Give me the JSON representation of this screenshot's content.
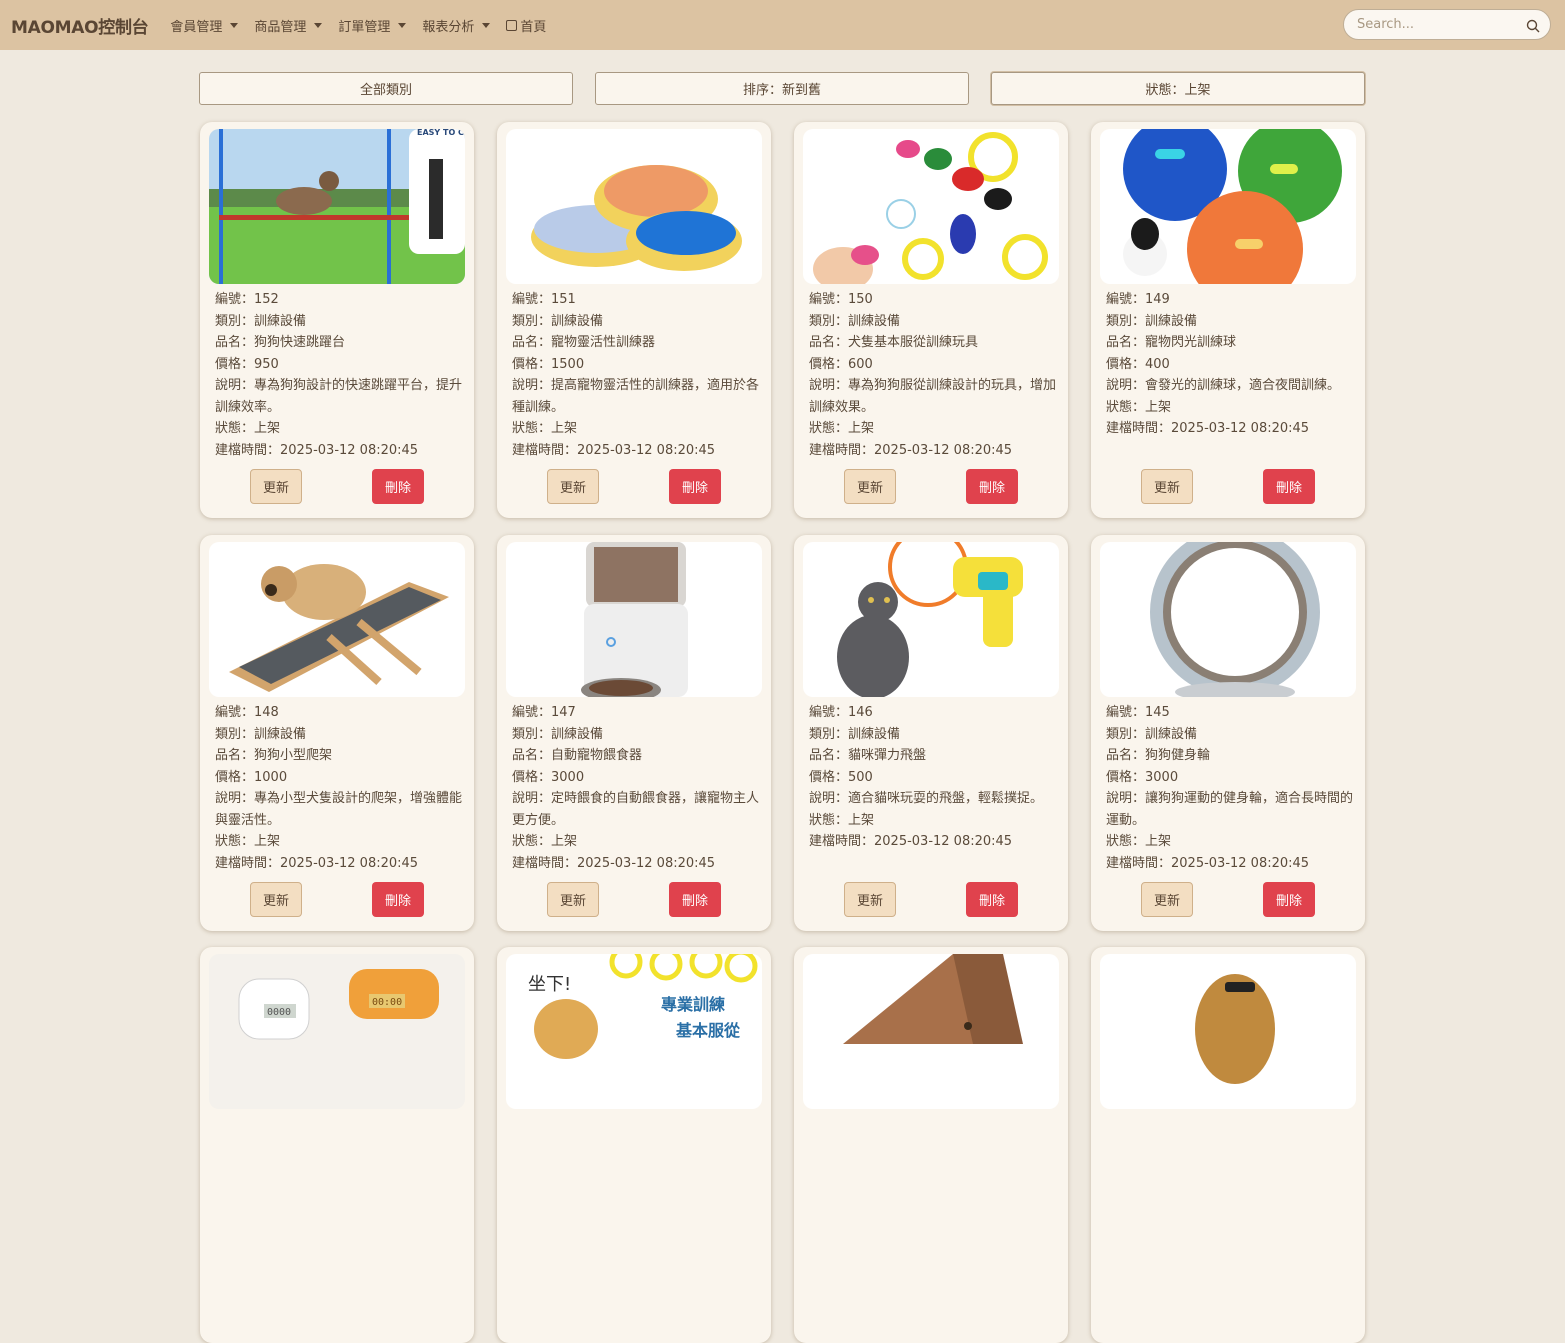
{
  "nav": {
    "brand": "MAOMAO控制台",
    "menu": [
      "會員管理",
      "商品管理",
      "訂單管理",
      "報表分析"
    ],
    "home": "首頁",
    "search_placeholder": "Search..."
  },
  "filters": [
    "全部類別",
    "排序：新到舊",
    "狀態：上架"
  ],
  "products": [
    {
      "id": "編號：152",
      "cat": "類別：訓練設備",
      "name": "品名：狗狗快速跳躍台",
      "price": "價格：950",
      "desc": "說明：專為狗狗設計的快速跳躍平台，提升訓練效率。",
      "status": "狀態：上架",
      "time": "建檔時間：2025-03-12 08:20:45",
      "img_text": "EASY TO CARRY"
    },
    {
      "id": "編號：151",
      "cat": "類別：訓練設備",
      "name": "品名：寵物靈活性訓練器",
      "price": "價格：1500",
      "desc": "說明：提高寵物靈活性的訓練器，適用於各種訓練。",
      "status": "狀態：上架",
      "time": "建檔時間：2025-03-12 08:20:45"
    },
    {
      "id": "編號：150",
      "cat": "類別：訓練設備",
      "name": "品名：犬隻基本服從訓練玩具",
      "price": "價格：600",
      "desc": "說明：專為狗狗服從訓練設計的玩具，增加訓練效果。",
      "status": "狀態：上架",
      "time": "建檔時間：2025-03-12 08:20:45"
    },
    {
      "id": "編號：149",
      "cat": "類別：訓練設備",
      "name": "品名：寵物閃光訓練球",
      "price": "價格：400",
      "desc": "說明：會發光的訓練球，適合夜間訓練。",
      "status": "狀態：上架",
      "time": "建檔時間：2025-03-12 08:20:45"
    },
    {
      "id": "編號：148",
      "cat": "類別：訓練設備",
      "name": "品名：狗狗小型爬架",
      "price": "價格：1000",
      "desc": "說明：專為小型犬隻設計的爬架，增強體能與靈活性。",
      "status": "狀態：上架",
      "time": "建檔時間：2025-03-12 08:20:45"
    },
    {
      "id": "編號：147",
      "cat": "類別：訓練設備",
      "name": "品名：自動寵物餵食器",
      "price": "價格：3000",
      "desc": "說明：定時餵食的自動餵食器，讓寵物主人更方便。",
      "status": "狀態：上架",
      "time": "建檔時間：2025-03-12 08:20:45"
    },
    {
      "id": "編號：146",
      "cat": "類別：訓練設備",
      "name": "品名：貓咪彈力飛盤",
      "price": "價格：500",
      "desc": "說明：適合貓咪玩耍的飛盤，輕鬆撲捉。",
      "status": "狀態：上架",
      "time": "建檔時間：2025-03-12 08:20:45"
    },
    {
      "id": "編號：145",
      "cat": "類別：訓練設備",
      "name": "品名：狗狗健身輪",
      "price": "價格：3000",
      "desc": "說明：讓狗狗運動的健身輪，適合長時間的運動。",
      "status": "狀態：上架",
      "time": "建檔時間：2025-03-12 08:20:45"
    }
  ],
  "partial_cards": [
    {
      "img_text_1": "0000",
      "img_text_2": "00:00"
    },
    {
      "img_text_1": "坐下!",
      "img_text_2": "專業訓練",
      "img_text_3": "基本服從"
    },
    {},
    {}
  ],
  "buttons": {
    "update": "更新",
    "delete": "刪除"
  },
  "colors": {
    "navbar": "#dcc3a2",
    "background": "#efe9df",
    "card": "#faf5ed",
    "update": "#f3dec2",
    "delete": "#e0424d"
  }
}
